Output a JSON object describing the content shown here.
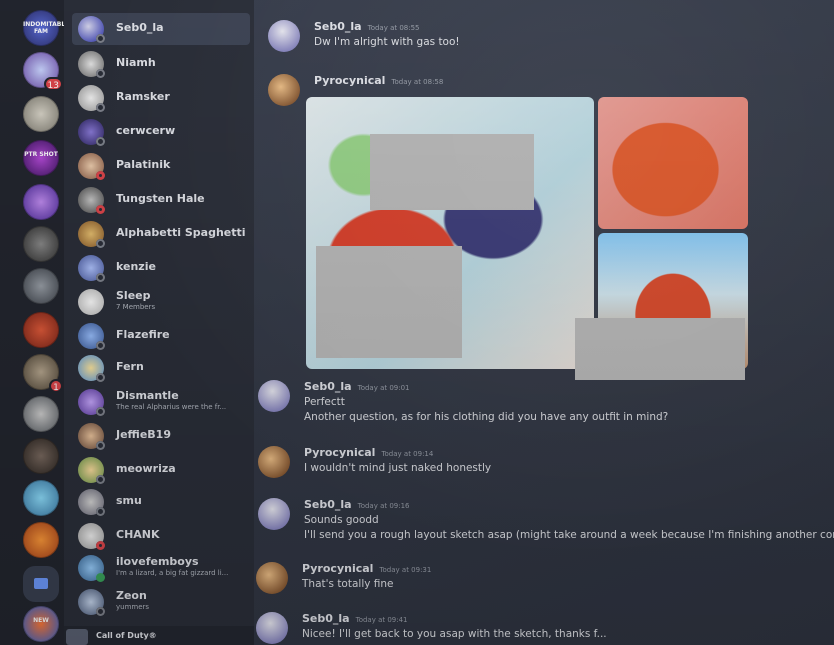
{
  "servers": [
    {
      "label": "INDOMITABLE FAM",
      "badge": ""
    },
    {
      "label": "",
      "badge": "13"
    },
    {
      "label": "",
      "badge": ""
    },
    {
      "label": "PTR SHOT",
      "badge": ""
    },
    {
      "label": "",
      "badge": ""
    },
    {
      "label": "",
      "badge": ""
    },
    {
      "label": "",
      "badge": ""
    },
    {
      "label": "",
      "badge": ""
    },
    {
      "label": "",
      "badge": "1"
    },
    {
      "label": "",
      "badge": ""
    },
    {
      "label": "",
      "badge": ""
    },
    {
      "label": "",
      "badge": ""
    },
    {
      "label": "",
      "badge": ""
    },
    {
      "label": "NEW",
      "badge": ""
    }
  ],
  "members": [
    {
      "name": "Seb0_la",
      "sub": "",
      "active": true,
      "status": "offline"
    },
    {
      "name": "Niamh",
      "sub": "",
      "active": false,
      "status": "offline"
    },
    {
      "name": "Ramsker",
      "sub": "",
      "active": false,
      "status": "offline"
    },
    {
      "name": "cerwcerw",
      "sub": "",
      "active": false,
      "status": "offline"
    },
    {
      "name": "Palatinik",
      "sub": "",
      "active": false,
      "status": "dnd"
    },
    {
      "name": "Tungsten Hale",
      "sub": "",
      "active": false,
      "status": "dnd"
    },
    {
      "name": "Alphabetti Spaghetti",
      "sub": "",
      "active": false,
      "status": "offline"
    },
    {
      "name": "kenzie",
      "sub": "",
      "active": false,
      "status": "offline"
    },
    {
      "name": "Sleep",
      "sub": "7 Members",
      "active": false,
      "status": "none"
    },
    {
      "name": "Flazefire",
      "sub": "",
      "active": false,
      "status": "offline"
    },
    {
      "name": "Fern",
      "sub": "",
      "active": false,
      "status": "offline"
    },
    {
      "name": "Dismantle",
      "sub": "The real Alpharius were the fr...",
      "active": false,
      "status": "offline"
    },
    {
      "name": "JeffieB19",
      "sub": "",
      "active": false,
      "status": "offline"
    },
    {
      "name": "meowriza",
      "sub": "",
      "active": false,
      "status": "offline"
    },
    {
      "name": "smu",
      "sub": "",
      "active": false,
      "status": "offline"
    },
    {
      "name": "CHANK",
      "sub": "",
      "active": false,
      "status": "dnd"
    },
    {
      "name": "ilovefemboys",
      "sub": "I'm a lizard, a big fat gizzard li...",
      "active": false,
      "status": "online"
    },
    {
      "name": "Zeon",
      "sub": "yummers",
      "active": false,
      "status": "offline"
    }
  ],
  "bottom_bar": {
    "label": "Call of Duty®"
  },
  "messages": [
    {
      "author": "Seb0_la",
      "time": "Today at 08:55",
      "lines": [
        "Dw I'm alright with gas too!"
      ]
    },
    {
      "author": "Pyrocynical",
      "time": "Today at 08:58",
      "lines": []
    },
    {
      "author": "Seb0_la",
      "time": "Today at 09:01",
      "lines": [
        "Perfectt",
        "Another question, as for his clothing did you have any outfit in mind?"
      ]
    },
    {
      "author": "Pyrocynical",
      "time": "Today at 09:14",
      "lines": [
        "I wouldn't mind just naked honestly"
      ]
    },
    {
      "author": "Seb0_la",
      "time": "Today at 09:16",
      "lines": [
        "Sounds goodd",
        "I'll send you a rough layout sketch asap (might take around a week because I'm finishing another com"
      ]
    },
    {
      "author": "Pyrocynical",
      "time": "Today at 09:31",
      "lines": [
        "That's totally fine"
      ]
    },
    {
      "author": "Seb0_la",
      "time": "Today at 09:41",
      "lines": [
        "Nicee! I'll get back to you asap with the sketch, thanks f..."
      ]
    }
  ]
}
